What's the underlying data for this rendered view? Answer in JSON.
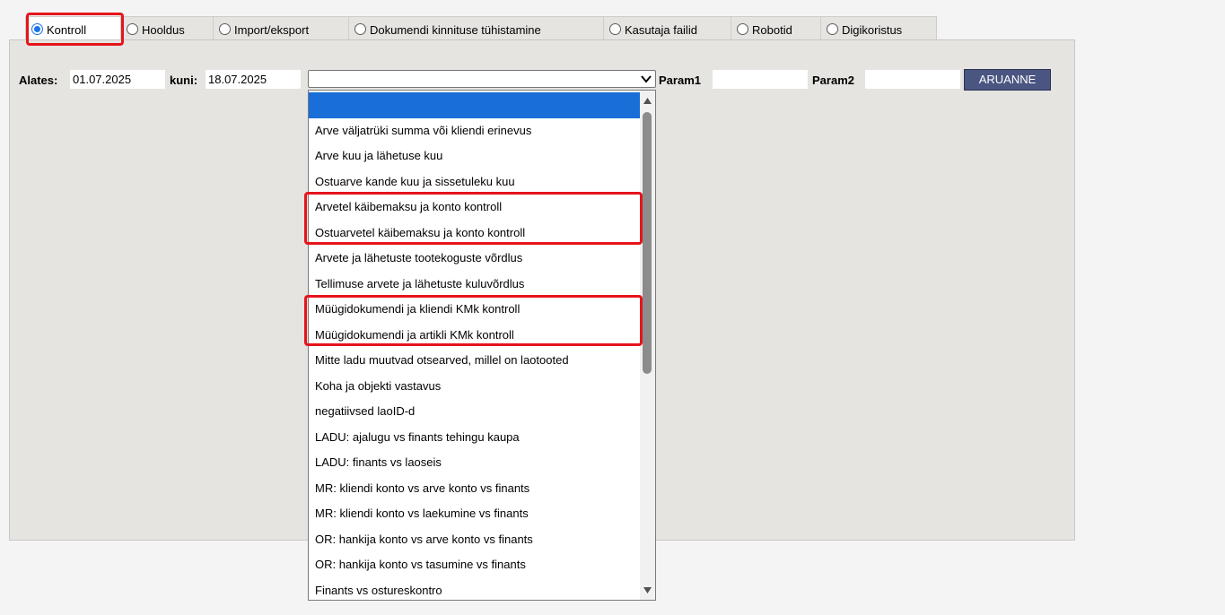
{
  "tabs": [
    {
      "label": "Kontroll",
      "checked": true
    },
    {
      "label": "Hooldus",
      "checked": false
    },
    {
      "label": "Import/eksport",
      "checked": false
    },
    {
      "label": "Dokumendi kinnituse tühistamine",
      "checked": false
    },
    {
      "label": "Kasutaja failid",
      "checked": false
    },
    {
      "label": "Robotid",
      "checked": false
    },
    {
      "label": "Digikoristus",
      "checked": false
    }
  ],
  "form": {
    "alates_label": "Alates:",
    "alates_value": "01.07.2025",
    "kuni_label": "kuni:",
    "kuni_value": "18.07.2025",
    "select_value": "",
    "param1_label": "Param1",
    "param1_value": "",
    "param2_label": "Param2",
    "param2_value": "",
    "report_button": "ARUANNE"
  },
  "dropdown": {
    "options": [
      "",
      "Arve väljatrüki summa või kliendi erinevus",
      "Arve kuu ja lähetuse kuu",
      "Ostuarve kande kuu ja sissetuleku kuu",
      "Arvetel käibemaksu ja konto kontroll",
      "Ostuarvetel käibemaksu ja konto kontroll",
      "Arvete ja lähetuste tootekoguste võrdlus",
      "Tellimuse arvete ja lähetuste kuluvõrdlus",
      "Müügidokumendi ja kliendi KMk kontroll",
      "Müügidokumendi ja artikli KMk kontroll",
      "Mitte ladu muutvad otsearved, millel on laotooted",
      "Koha ja objekti vastavus",
      "negatiivsed laoID-d",
      "LADU: ajalugu vs finants tehingu kaupa",
      "LADU: finants vs laoseis",
      "MR: kliendi konto vs arve konto vs finants",
      "MR: kliendi konto vs laekumine vs finants",
      "OR: hankija konto vs arve konto vs finants",
      "OR: hankija konto vs tasumine vs finants",
      "Finants vs ostureskontro"
    ],
    "selected_index": 0
  },
  "colors": {
    "accent": "#1a6ed8",
    "highlight": "#e6141c",
    "button": "#4b5581"
  },
  "icons": [
    "radio-icon",
    "chevron-down-icon",
    "scroll-up-arrow-icon",
    "scroll-down-arrow-icon"
  ]
}
